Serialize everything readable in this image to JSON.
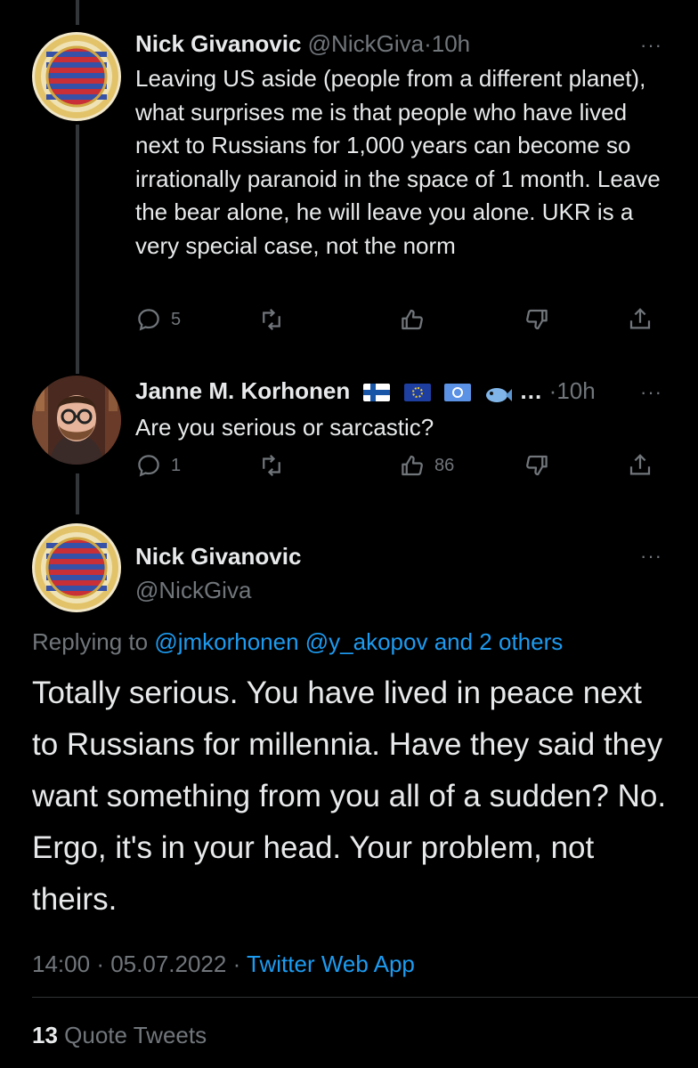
{
  "tweet1": {
    "name": "Nick Givanovic",
    "handle": "@NickGiva",
    "dot": "·",
    "time": "10h",
    "more": "···",
    "text": "Leaving US aside (people from a different planet), what surprises me is that people who have lived next to Russians for 1,000 years can become so irrationally paranoid in the space of 1 month. Leave the bear alone, he will leave you alone. UKR is a very special case, not the norm",
    "replies": "5",
    "retweets": "",
    "likes": ""
  },
  "tweet2": {
    "name": "Janne M. Korhonen",
    "name_suffix": "…",
    "dot": "·",
    "time": "10h",
    "more": "···",
    "text": "Are you serious or sarcastic?",
    "replies": "1",
    "retweets": "",
    "likes": "86",
    "badges": [
      "finland-flag",
      "eu-flag",
      "un-flag",
      "fish-emoji"
    ]
  },
  "main_tweet": {
    "name": "Nick Givanovic",
    "handle": "@NickGiva",
    "more": "···",
    "replying_prefix": "Replying to",
    "replying_to": "@jmkorhonen @y_akopov and 2 others",
    "text": "Totally serious.  You have lived in peace next to Russians for millennia. Have they said they want something from you all of a sudden? No. Ergo, it's in your head. Your problem, not theirs.",
    "time": "14:00",
    "dot1": "·",
    "date": "05.07.2022",
    "dot2": "·",
    "source": "Twitter Web App",
    "quote_count": "13",
    "quote_label": "Quote Tweets"
  },
  "colors": {
    "background": "#000000",
    "text": "#e7e9ea",
    "muted": "#71767b",
    "link": "#1d9bf0",
    "divider": "#2f3336"
  }
}
